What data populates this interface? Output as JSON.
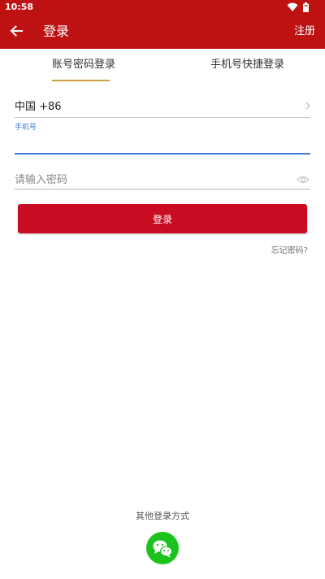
{
  "status_bar": {
    "time": "10:58",
    "icons": [
      "wifi-icon",
      "battery-icon"
    ]
  },
  "header": {
    "back_icon": "arrow-left-icon",
    "title": "登录",
    "register_label": "注册"
  },
  "tabs": [
    {
      "label": "账号密码登录",
      "active": true
    },
    {
      "label": "手机号快捷登录",
      "active": false
    }
  ],
  "form": {
    "country_code": "中国 +86",
    "phone_label": "手机号",
    "phone_value": "",
    "password_placeholder": "请输入密码",
    "login_label": "登录",
    "forgot_label": "忘记密码?"
  },
  "footer": {
    "other_login_label": "其他登录方式",
    "wechat_icon": "wechat-icon"
  },
  "colors": {
    "header_bg": "#be1212",
    "login_button": "#c90c22",
    "tab_indicator": "#c9a042",
    "phone_accent": "#3a7dd6",
    "wechat_green": "#1dc21c"
  }
}
